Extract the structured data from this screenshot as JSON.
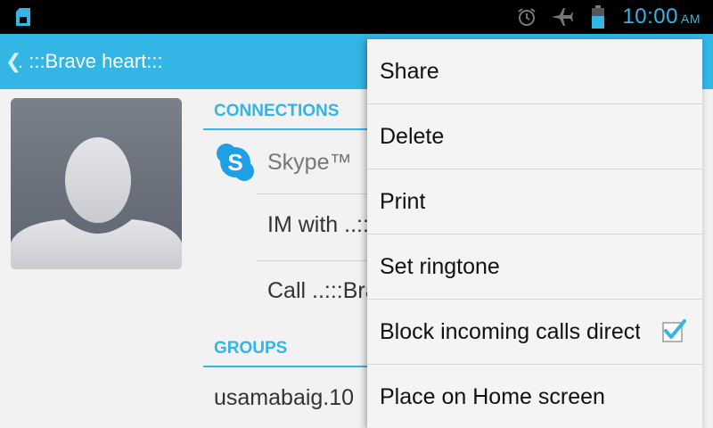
{
  "status_bar": {
    "time": "10:00",
    "ampm": "AM",
    "icons": [
      "sim-card-icon",
      "alarm-icon",
      "airplane-mode-icon",
      "battery-icon"
    ]
  },
  "action_bar": {
    "back_glyph": "❮",
    "title": ". :::Brave heart:::"
  },
  "connections": {
    "header": "CONNECTIONS",
    "app_name": "Skype™",
    "rows": [
      "IM with ..:::Brave heart:::",
      "Call ..:::Brave heart:::"
    ]
  },
  "groups": {
    "header": "GROUPS",
    "value": "usamabaig.10"
  },
  "menu": {
    "items": [
      {
        "label": "Share"
      },
      {
        "label": "Delete"
      },
      {
        "label": "Print"
      },
      {
        "label": "Set ringtone"
      },
      {
        "label": "Block incoming calls directly",
        "checked": true
      },
      {
        "label": "Place on Home screen"
      }
    ]
  },
  "colors": {
    "accent": "#33b5e5",
    "status_bar": "#000000",
    "background": "#f2f2f2",
    "menu_background": "#f4f4f4"
  }
}
